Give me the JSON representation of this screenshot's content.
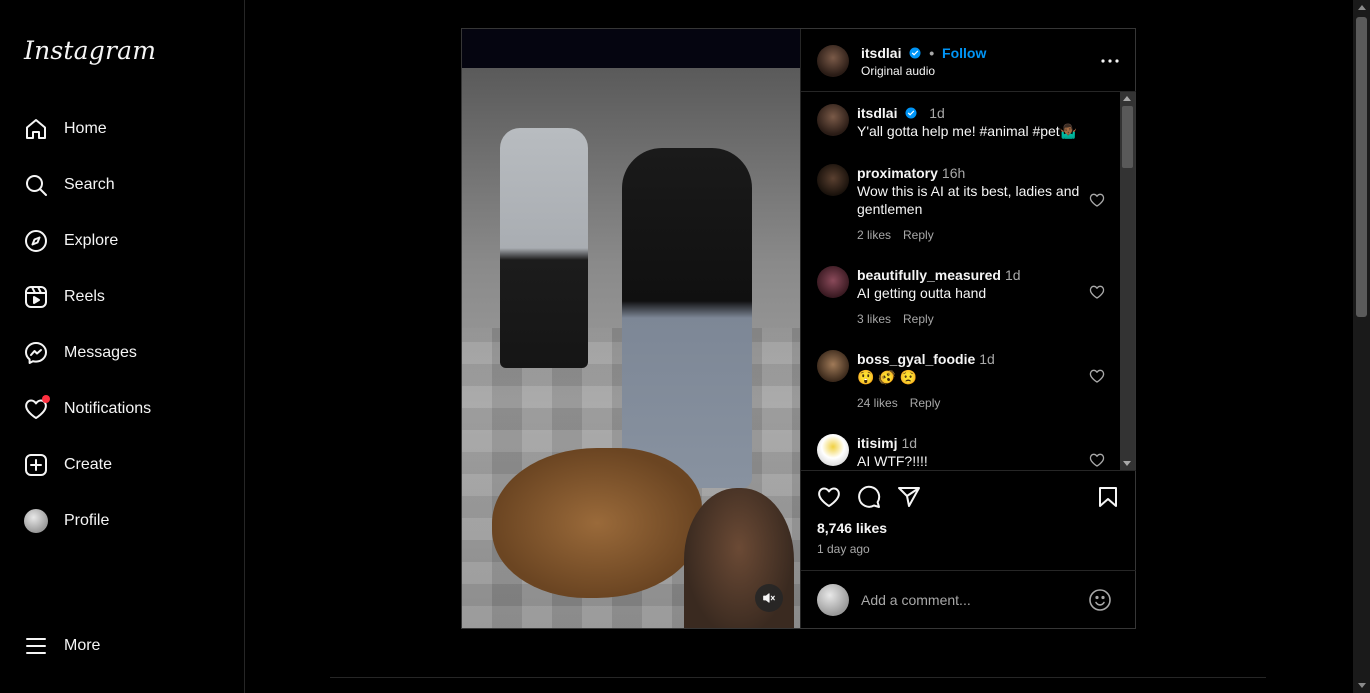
{
  "app": {
    "logo": "Instagram"
  },
  "sidebar": {
    "items": [
      {
        "label": "Home",
        "icon": "home-icon"
      },
      {
        "label": "Search",
        "icon": "search-icon"
      },
      {
        "label": "Explore",
        "icon": "compass-icon"
      },
      {
        "label": "Reels",
        "icon": "reels-icon"
      },
      {
        "label": "Messages",
        "icon": "messenger-icon"
      },
      {
        "label": "Notifications",
        "icon": "heart-icon"
      },
      {
        "label": "Create",
        "icon": "plus-square-icon"
      },
      {
        "label": "Profile",
        "icon": "avatar"
      }
    ],
    "more": {
      "label": "More",
      "icon": "menu-icon"
    }
  },
  "post": {
    "author": "itsdlai",
    "follow_label": "Follow",
    "separator": "•",
    "audio": "Original audio",
    "caption": {
      "user": "itsdlai",
      "time": "1d",
      "text": "Y'all gotta help me! #animal #pet🤷🏾‍♂️"
    },
    "comments": [
      {
        "user": "proximatory",
        "time": "16h",
        "text": "Wow this is AI at its best, ladies and gentlemen",
        "likes": "2 likes",
        "reply": "Reply"
      },
      {
        "user": "beautifully_measured",
        "time": "1d",
        "text": "AI getting outta hand",
        "likes": "3 likes",
        "reply": "Reply"
      },
      {
        "user": "boss_gyal_foodie",
        "time": "1d",
        "text": "😲 🫨 😟",
        "likes": "24 likes",
        "reply": "Reply"
      },
      {
        "user": "itisimj",
        "time": "1d",
        "text": "AI WTF?!!!!",
        "likes": "",
        "reply": ""
      }
    ],
    "likes_count": "8,746 likes",
    "posted": "1 day ago",
    "add_comment_placeholder": "Add a comment..."
  },
  "colors": {
    "accent": "#0095f6",
    "verified": "#0095f6",
    "notification_dot": "#ff3040",
    "background": "#000000"
  }
}
